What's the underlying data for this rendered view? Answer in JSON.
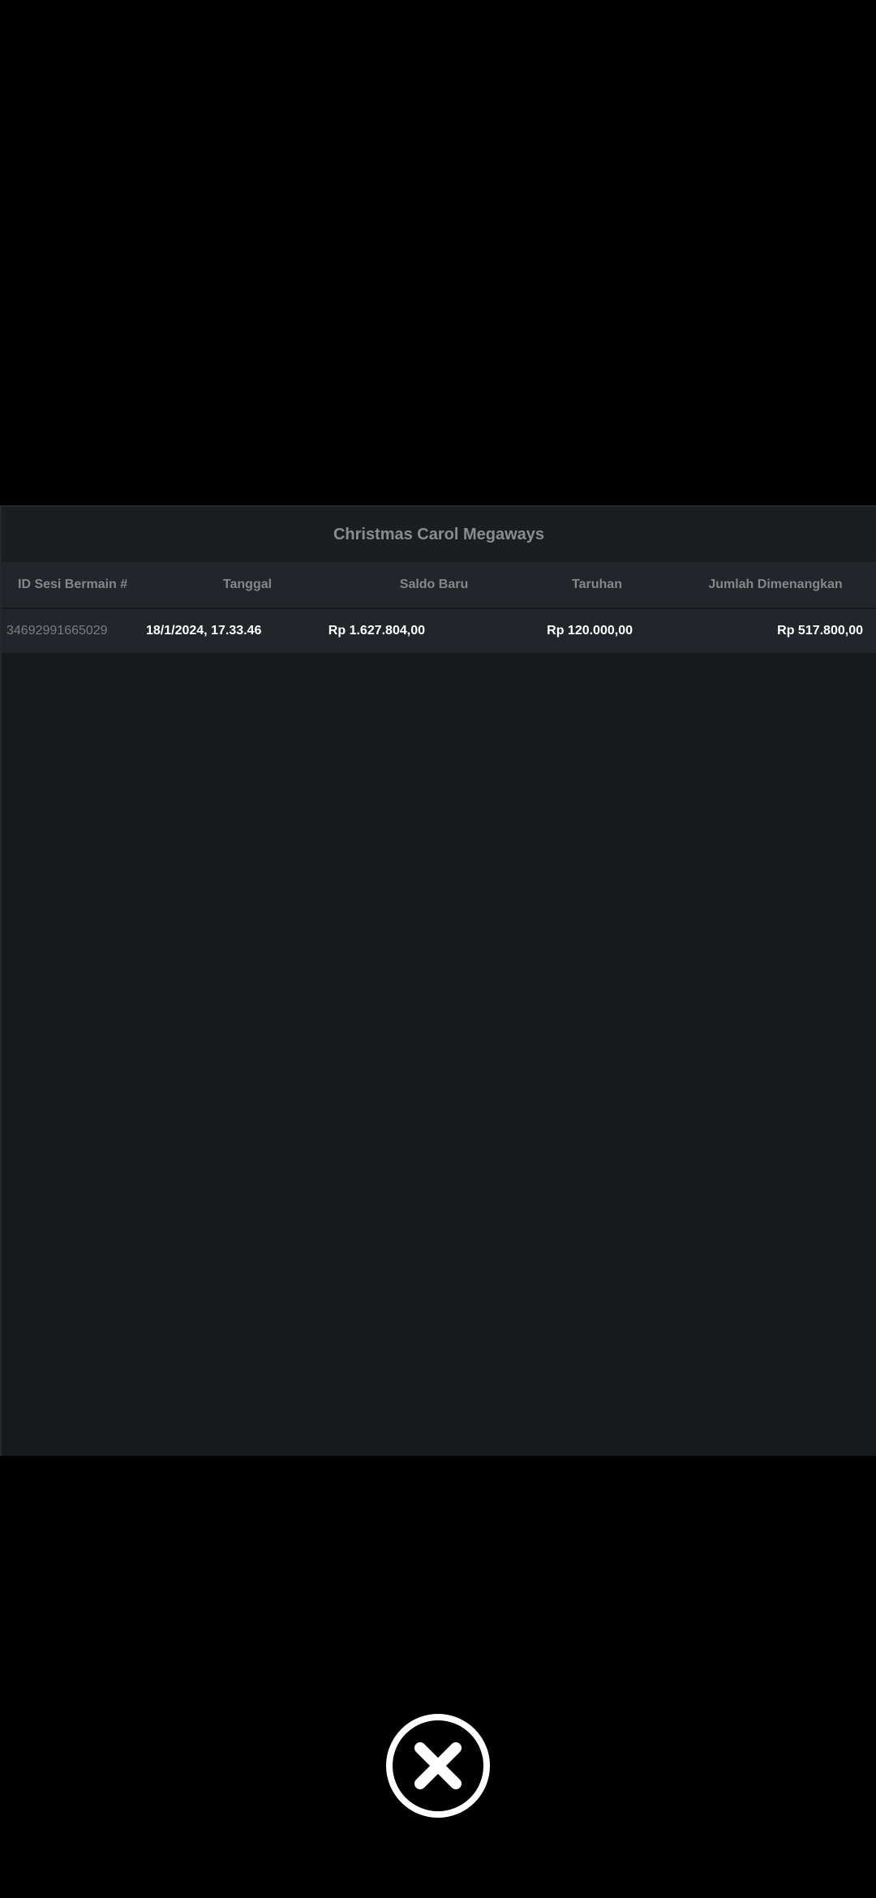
{
  "modal": {
    "title": "Christmas Carol Megaways"
  },
  "table": {
    "headers": [
      "ID Sesi Bermain #",
      "Tanggal",
      "Saldo Baru",
      "Taruhan",
      "Jumlah Dimenangkan"
    ],
    "rows": [
      {
        "session_id": "34692991665029",
        "date": "18/1/2024, 17.33.46",
        "new_balance": "Rp 1.627.804,00",
        "bet": "Rp 120.000,00",
        "amount_won": "Rp 517.800,00"
      }
    ]
  },
  "close_button": {
    "icon": "close-icon"
  }
}
